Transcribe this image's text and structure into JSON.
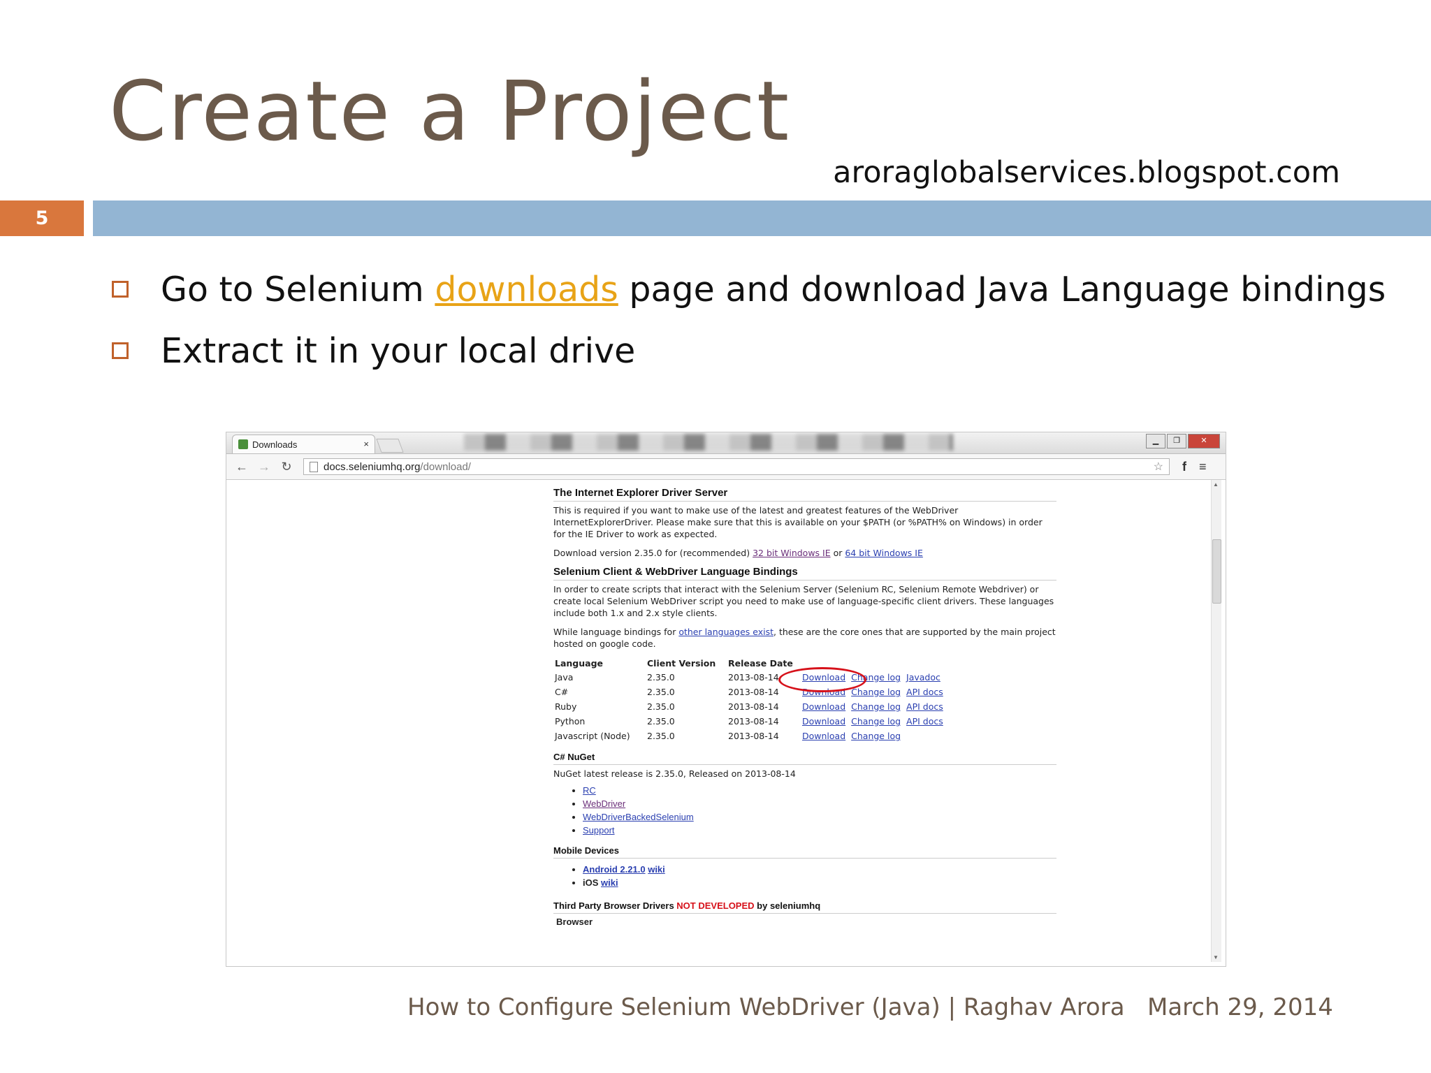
{
  "slide": {
    "title": "Create a Project",
    "site_url": "aroraglobalservices.blogspot.com",
    "number": "5",
    "bullets": [
      {
        "prefix": "Go to Selenium ",
        "link": "downloads",
        "suffix": " page and download Java Language bindings"
      },
      {
        "text": "Extract it in your local drive"
      }
    ],
    "footer_left": "How to Configure Selenium WebDriver (Java) | Raghav Arora",
    "footer_right": "March 29, 2014"
  },
  "browser": {
    "tab_title": "Downloads",
    "tab_close": "×",
    "url_host": "docs.seleniumhq.org",
    "url_path": "/download/",
    "window_buttons": [
      "▁",
      "❐",
      "✕"
    ]
  },
  "page": {
    "ie_section": {
      "heading": "The Internet Explorer Driver Server",
      "description": "This is required if you want to make use of the latest and greatest features of the WebDriver InternetExplorerDriver. Please make sure that this is available on your $PATH (or %PATH% on Windows) in order for the IE Driver to work as expected.",
      "download_prefix": "Download version 2.35.0 for (recommended) ",
      "link_32": "32 bit Windows IE",
      "or": " or ",
      "link_64": "64 bit Windows IE"
    },
    "bindings_section": {
      "heading": "Selenium Client & WebDriver Language Bindings",
      "description": "In order to create scripts that interact with the Selenium Server (Selenium RC, Selenium Remote Webdriver) or create local Selenium WebDriver script you need to make use of language-specific client drivers. These languages include both 1.x and 2.x style clients.",
      "note_prefix": "While language bindings for ",
      "note_link": "other languages exist",
      "note_suffix": ", these are the core ones that are supported by the main project hosted on google code.",
      "columns": [
        "Language",
        "Client Version",
        "Release Date"
      ],
      "rows": [
        {
          "language": "Java",
          "version": "2.35.0",
          "date": "2013-08-14",
          "download": "Download",
          "changelog": "Change log",
          "docs": "Javadoc"
        },
        {
          "language": "C#",
          "version": "2.35.0",
          "date": "2013-08-14",
          "download": "Download",
          "changelog": "Change log",
          "docs": "API docs"
        },
        {
          "language": "Ruby",
          "version": "2.35.0",
          "date": "2013-08-14",
          "download": "Download",
          "changelog": "Change log",
          "docs": "API docs"
        },
        {
          "language": "Python",
          "version": "2.35.0",
          "date": "2013-08-14",
          "download": "Download",
          "changelog": "Change log",
          "docs": "API docs"
        },
        {
          "language": "Javascript (Node)",
          "version": "2.35.0",
          "date": "2013-08-14",
          "download": "Download",
          "changelog": "Change log",
          "docs": ""
        }
      ]
    },
    "nuget_section": {
      "heading": "C# NuGet",
      "description": "NuGet latest release is 2.35.0, Released on 2013-08-14",
      "links": [
        "RC",
        "WebDriver",
        "WebDriverBackedSelenium",
        "Support"
      ]
    },
    "mobile_section": {
      "heading": "Mobile Devices",
      "android_link": "Android 2.21.0",
      "android_wiki": "wiki",
      "ios_label": "iOS ",
      "ios_wiki": "wiki"
    },
    "third_party_section": {
      "heading_prefix": "Third Party Browser Drivers ",
      "heading_highlight": "NOT DEVELOPED",
      "heading_suffix": " by seleniumhq",
      "subheading": "Browser"
    }
  },
  "colors": {
    "title": "#6b5a4b",
    "accent_orange": "#d9773d",
    "band_blue": "#93b5d3",
    "link_yellow": "#e8a317",
    "annotation_red": "#d6111a"
  }
}
